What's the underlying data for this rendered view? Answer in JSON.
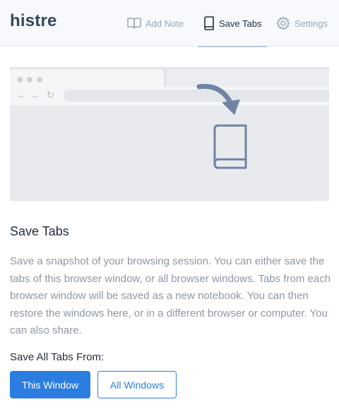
{
  "app": {
    "logo": "histre"
  },
  "nav": {
    "add_note": {
      "label": "Add Note",
      "icon": "open-book-icon"
    },
    "save_tabs": {
      "label": "Save Tabs",
      "icon": "notebook-icon",
      "active": true
    },
    "settings": {
      "label": "Settings",
      "icon": "gear-icon"
    }
  },
  "hero": {
    "icons": [
      "back-arrow-icon",
      "forward-arrow-icon",
      "reload-icon",
      "curved-arrow-icon",
      "notebook-icon"
    ]
  },
  "main": {
    "title": "Save Tabs",
    "description": "Save a snapshot of your browsing session. You can either save the tabs of this browser window, or all browser windows. Tabs from each browser window will be saved as a new notebook. You can then restore the windows here, or in a different browser or computer. You can also share.",
    "save_from_label": "Save All Tabs From:",
    "buttons": {
      "this_window": "This Window",
      "all_windows": "All Windows"
    }
  },
  "colors": {
    "accent": "#2b7de0",
    "header_bg": "#f7f9fc",
    "muted_text": "#8c98a6",
    "illustration_icon": "#6e84a3"
  }
}
